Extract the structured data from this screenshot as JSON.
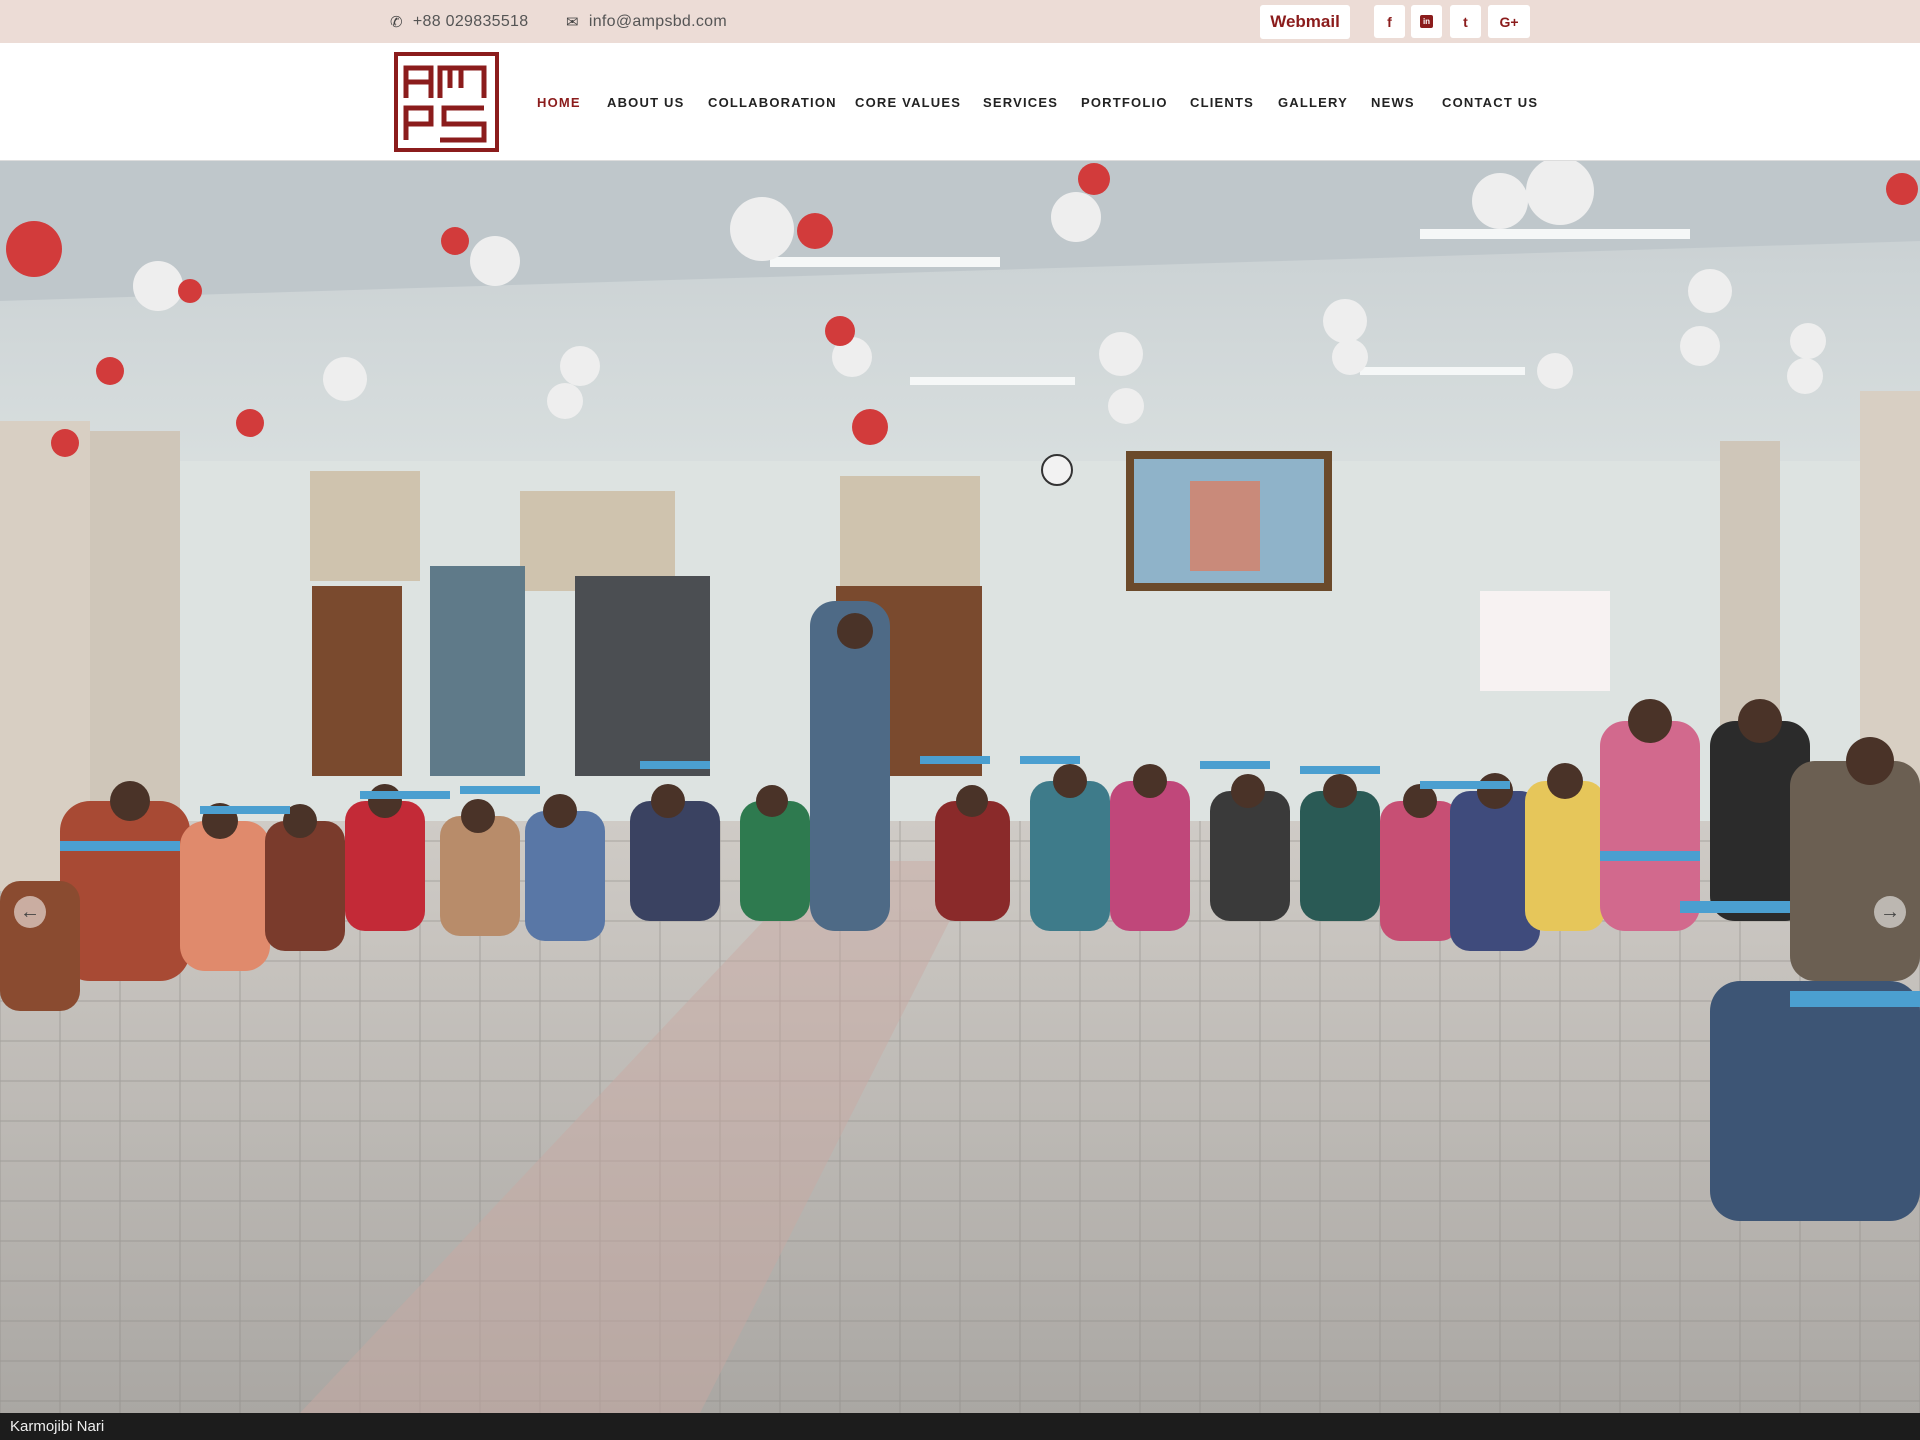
{
  "topbar": {
    "phone_icon": "phone-icon",
    "phone": "+88 029835518",
    "email_icon": "envelope-icon",
    "email": "info@ampsbd.com",
    "webmail_label": "Webmail",
    "social": [
      {
        "name": "facebook-icon",
        "glyph": "f"
      },
      {
        "name": "linkedin-icon",
        "glyph": "in"
      },
      {
        "name": "twitter-icon",
        "glyph": "t"
      },
      {
        "name": "google-plus-icon",
        "glyph": "G+"
      }
    ]
  },
  "header": {
    "logo_text": "AMPS",
    "nav": [
      {
        "label": "HOME",
        "active": true
      },
      {
        "label": "ABOUT US"
      },
      {
        "label": "COLLABORATION"
      },
      {
        "label": "CORE VALUES"
      },
      {
        "label": "SERVICES"
      },
      {
        "label": "PORTFOLIO"
      },
      {
        "label": "CLIENTS"
      },
      {
        "label": "GALLERY"
      },
      {
        "label": "NEWS"
      },
      {
        "label": "CONTACT US"
      }
    ]
  },
  "slider": {
    "prev_icon": "arrow-left-icon",
    "next_icon": "arrow-right-icon",
    "caption": "Karmojibi Nari"
  },
  "colors": {
    "brand": "#8b1c1c",
    "topbar_bg": "#ecdcd6",
    "caption_bg": "#1c1c1c"
  }
}
